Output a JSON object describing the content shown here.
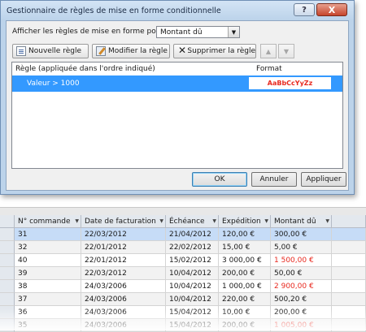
{
  "dialog": {
    "title": "Gestionnaire de règles de mise en forme conditionnelle",
    "help_glyph": "?",
    "close_glyph": "X",
    "show_rules_label": "Afficher les règles de mise en forme pour :",
    "show_rules_value": "Montant dû",
    "toolbar": {
      "new_rule": "Nouvelle règle",
      "edit_rule": "Modifier la règle",
      "delete_rule": "Supprimer la règle",
      "move_up_glyph": "▲",
      "move_down_glyph": "▼"
    },
    "rules_header": {
      "rule": "Règle (appliquée dans l'ordre indiqué)",
      "format": "Format"
    },
    "rules": [
      {
        "rule": "Valeur > 1000",
        "format_preview": "AaBbCcYyZz",
        "format_color": "#e8281e"
      }
    ],
    "buttons": {
      "ok": "OK",
      "cancel": "Annuler",
      "apply": "Appliquer"
    }
  },
  "worksheet": {
    "columns": [
      "N° commande",
      "Date de facturation",
      "Échéance",
      "Expédition",
      "Montant dû"
    ],
    "filter_glyph": "▼",
    "rows": [
      {
        "cells": [
          "31",
          "22/03/2012",
          "21/04/2012",
          "120,00 €",
          "300,00 €"
        ],
        "highlight": false,
        "selected": true
      },
      {
        "cells": [
          "32",
          "22/01/2012",
          "22/02/2012",
          "15,00 €",
          "5,00 €"
        ],
        "highlight": false,
        "selected": false
      },
      {
        "cells": [
          "40",
          "22/01/2012",
          "15/02/2012",
          "3 000,00 €",
          "1 500,00 €"
        ],
        "highlight": true,
        "selected": false
      },
      {
        "cells": [
          "39",
          "22/03/2012",
          "10/04/2012",
          "200,00 €",
          "50,00 €"
        ],
        "highlight": false,
        "selected": false
      },
      {
        "cells": [
          "38",
          "24/03/2006",
          "10/04/2012",
          "1 000,00 €",
          "2 900,00 €"
        ],
        "highlight": true,
        "selected": false
      },
      {
        "cells": [
          "37",
          "24/03/2006",
          "10/04/2012",
          "220,00 €",
          "500,20 €"
        ],
        "highlight": false,
        "selected": false
      },
      {
        "cells": [
          "36",
          "24/03/2006",
          "15/04/2012",
          "10,00 €",
          "200,00 €"
        ],
        "highlight": false,
        "selected": false
      },
      {
        "cells": [
          "35",
          "24/03/2006",
          "15/04/2012",
          "200,00 €",
          "1 005,00 €"
        ],
        "highlight": true,
        "selected": false
      }
    ]
  },
  "colors": {
    "highlight_text": "#e8281e",
    "selection_row": "#3399ff"
  }
}
